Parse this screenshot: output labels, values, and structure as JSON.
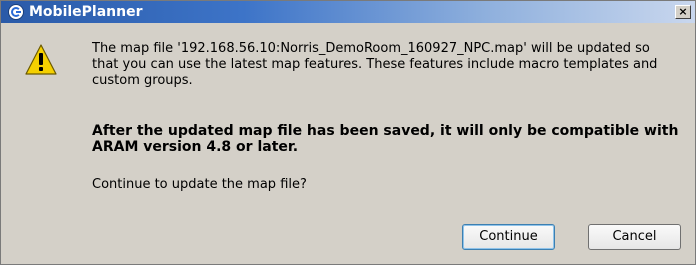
{
  "window": {
    "title": "MobilePlanner",
    "close_glyph": "×"
  },
  "icons": {
    "app": "app-logo-icon",
    "warning": "warning-icon"
  },
  "message": {
    "line1": "The map file '192.168.56.10:Norris_DemoRoom_160927_NPC.map' will be updated so that you can use the latest map features. These features include macro templates and custom groups.",
    "line2": "After the updated map file has been saved, it will only be compatible with ARAM version 4.8 or later.",
    "line3": "Continue to update the map file?"
  },
  "buttons": {
    "continue_label": "Continue",
    "cancel_label": "Cancel"
  },
  "colors": {
    "titlebar_start": "#2a5aa8",
    "titlebar_end": "#c9d7ee",
    "warning_yellow": "#f5d000",
    "dialog_bg": "#d4d0c8"
  }
}
